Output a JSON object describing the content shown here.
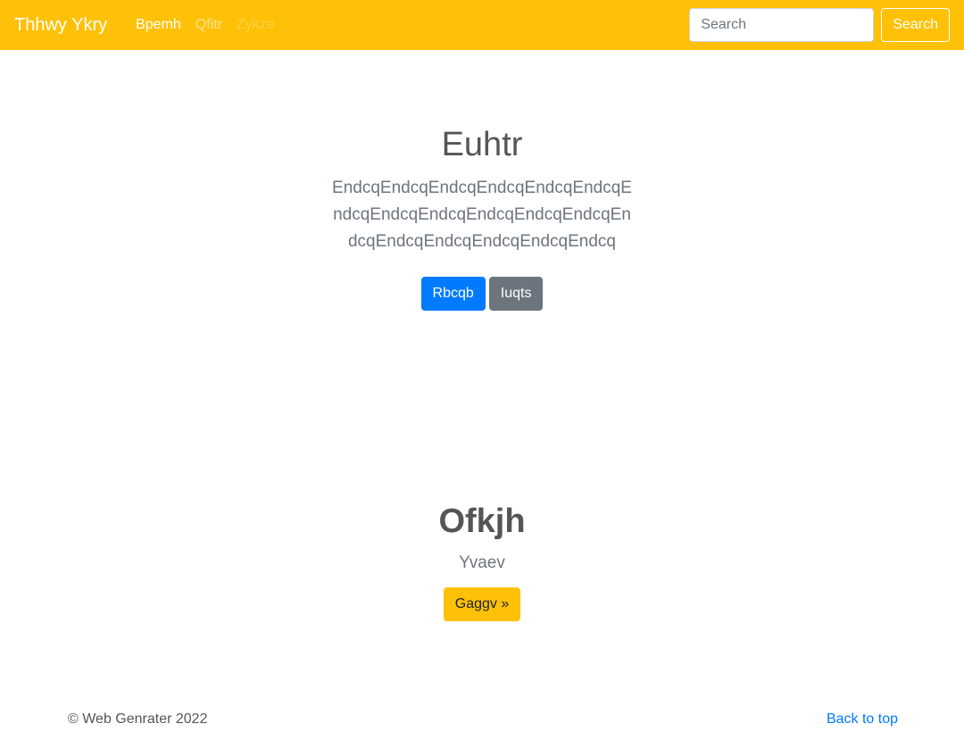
{
  "navbar": {
    "brand": "Thhwy Ykry",
    "links": [
      {
        "label": "Bpemh",
        "state": "active"
      },
      {
        "label": "Qfitr",
        "state": "normal"
      },
      {
        "label": "Zykze",
        "state": "disabled"
      }
    ],
    "search_placeholder": "Search",
    "search_button": "Search",
    "bg_color": "#ffc107"
  },
  "hero": {
    "title": "Euhtr",
    "lead": "EndcqEndcqEndcqEndcqEndcqEndcqEndcqEndcqEndcqEndcqEndcqEndcqEndcqEndcqEndcqEndcqEndcqEndcq",
    "primary_button": "Rbcqb",
    "secondary_button": "Iuqts"
  },
  "feature": {
    "title": "Ofkjh",
    "text": "Yvaev",
    "button": "Gaggv »"
  },
  "footer": {
    "copyright": "© Web Genrater 2022",
    "back_to_top": "Back to top"
  }
}
